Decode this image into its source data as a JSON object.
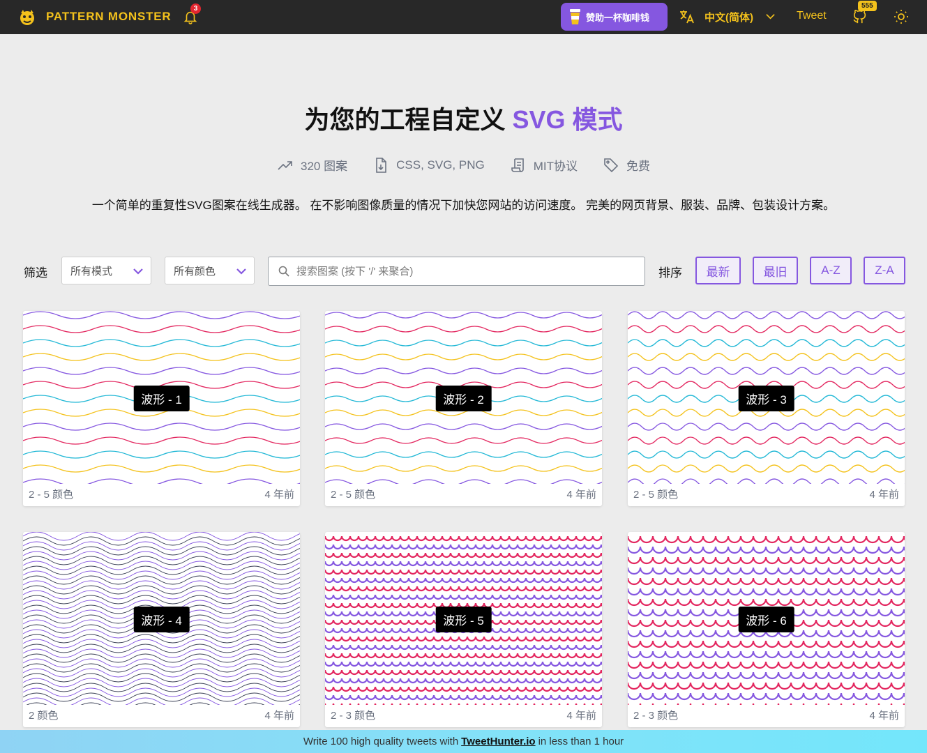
{
  "header": {
    "brand": "PATTERN MONSTER",
    "notification_count": "3",
    "donate_label": "赞助一杯咖啡钱",
    "language": "中文(简体)",
    "tweet_label": "Tweet",
    "github_stars": "555",
    "accent_color": "#8557e0",
    "brand_color": "#f4c21c"
  },
  "hero": {
    "title_main": "为您的工程自定义 ",
    "title_accent": "SVG 模式",
    "stats": [
      {
        "icon": "trending-up-icon",
        "label": "320 图案"
      },
      {
        "icon": "file-download-icon",
        "label": "CSS, SVG, PNG"
      },
      {
        "icon": "license-icon",
        "label": "MIT协议"
      },
      {
        "icon": "tag-icon",
        "label": "免费"
      }
    ],
    "tagline": "一个简单的重复性SVG图案在线生成器。 在不影响图像质量的情况下加快您网站的访问速度。 完美的网页背景、服装、品牌、包装设计方案。"
  },
  "filters": {
    "label": "筛选",
    "mode_select": "所有模式",
    "color_select": "所有颜色",
    "search_placeholder": "搜索图案 (按下 '/' 来聚合)",
    "sort_label": "排序",
    "sort_options": [
      "最新",
      "最旧",
      "A-Z",
      "Z-A"
    ]
  },
  "cards": [
    {
      "name": "波形 - 1",
      "colors": "2 - 5 颜色",
      "age": "4 年前"
    },
    {
      "name": "波形 - 2",
      "colors": "2 - 5 颜色",
      "age": "4 年前"
    },
    {
      "name": "波形 - 3",
      "colors": "2 - 5 颜色",
      "age": "4 年前"
    },
    {
      "name": "波形 - 4",
      "colors": "2 颜色",
      "age": "4 年前"
    },
    {
      "name": "波形 - 5",
      "colors": "2 - 3 颜色",
      "age": "4 年前"
    },
    {
      "name": "波形 - 6",
      "colors": "2 - 3 颜色",
      "age": "4 年前"
    }
  ],
  "pattern_colors": {
    "multi": [
      "#8557e0",
      "#e3265f",
      "#22b8d6",
      "#f4c21c"
    ],
    "purple": "#8557e0",
    "pink": "#e3265f"
  },
  "banner": {
    "prefix": "Write 100 high quality tweets with",
    "link": "TweetHunter.io",
    "suffix": "in less than 1 hour"
  }
}
